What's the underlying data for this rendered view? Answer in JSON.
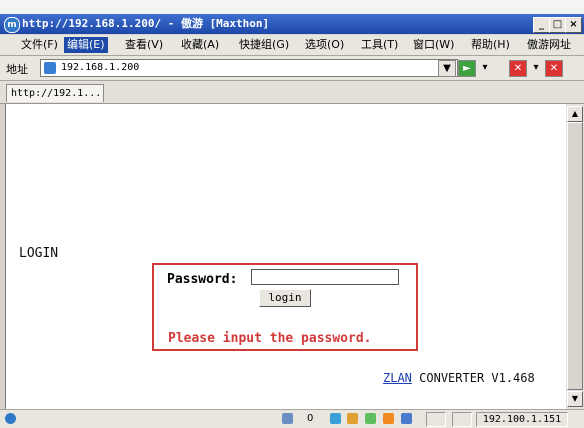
{
  "window": {
    "title": "http://192.168.1.200/ - 傲游 [Maxthon]",
    "controls": [
      "_",
      "□",
      "×"
    ]
  },
  "menu": {
    "items": [
      "文件(F)",
      "编辑(E)",
      "查看(V)",
      "收藏(A)",
      "快捷组(G)",
      "选项(O)",
      "工具(T)",
      "窗口(W)",
      "帮助(H)",
      "傲游网址"
    ]
  },
  "address": {
    "label": "地址",
    "url": "192.168.1.200"
  },
  "tab": {
    "label": "http://192.1..."
  },
  "page": {
    "heading": "LOGIN",
    "password_label": "Password:",
    "password_value": "",
    "login_button": "login",
    "error": "Please input the password.",
    "footer_link": "ZLAN",
    "footer_text": "CONVERTER V1.468"
  },
  "status": {
    "count": "0",
    "ip": "192.100.1.151"
  }
}
